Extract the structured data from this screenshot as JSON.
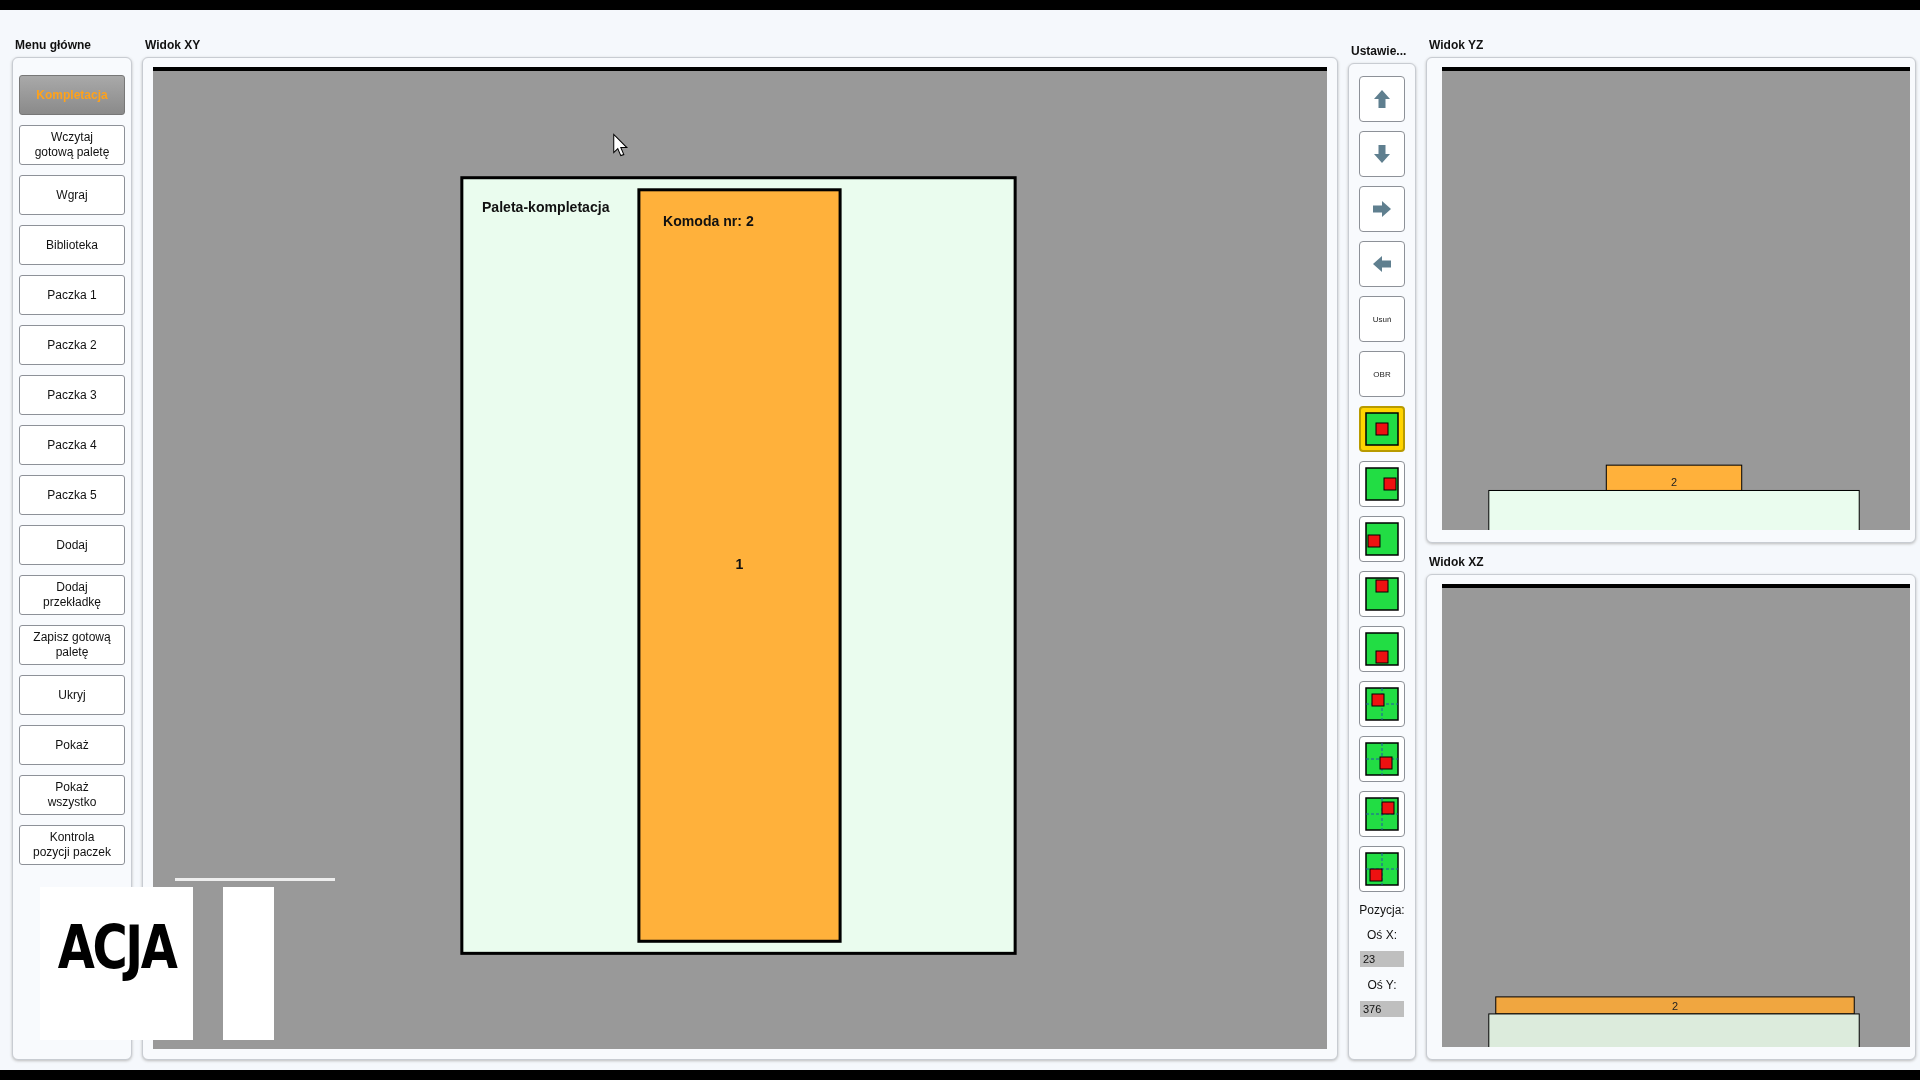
{
  "menu": {
    "title": "Menu główne",
    "items": [
      {
        "label": "Kompletacja",
        "selected": true
      },
      {
        "label": "Wczytaj gotową paletę",
        "selected": false
      },
      {
        "label": "Wgraj",
        "selected": false
      },
      {
        "label": "Biblioteka",
        "selected": false
      },
      {
        "label": "Paczka 1",
        "selected": false
      },
      {
        "label": "Paczka 2",
        "selected": false
      },
      {
        "label": "Paczka 3",
        "selected": false
      },
      {
        "label": "Paczka 4",
        "selected": false
      },
      {
        "label": "Paczka 5",
        "selected": false
      },
      {
        "label": "Dodaj",
        "selected": false
      },
      {
        "label": "Dodaj przekładkę",
        "selected": false
      },
      {
        "label": "Zapisz gotową paletę",
        "selected": false
      },
      {
        "label": "Ukryj",
        "selected": false
      },
      {
        "label": "Pokaż",
        "selected": false
      },
      {
        "label": "Pokaż wszystko",
        "selected": false
      },
      {
        "label": "Kontrola pozycji paczek",
        "selected": false
      }
    ]
  },
  "xy_view": {
    "title": "Widok XY",
    "pallet_label": "Paleta-kompletacja",
    "box_title": "Komoda nr: 2",
    "box_number": "1"
  },
  "settings": {
    "title": "Ustawie...",
    "tools": [
      {
        "kind": "up",
        "selected": false
      },
      {
        "kind": "down",
        "selected": false
      },
      {
        "kind": "right",
        "selected": false
      },
      {
        "kind": "left",
        "selected": false
      },
      {
        "kind": "label",
        "label": "Usuń",
        "selected": false
      },
      {
        "kind": "label",
        "label": "OBR",
        "selected": false
      },
      {
        "kind": "center",
        "selected": true
      },
      {
        "kind": "east",
        "selected": false
      },
      {
        "kind": "west",
        "selected": false
      },
      {
        "kind": "north",
        "selected": false
      },
      {
        "kind": "south",
        "selected": false
      },
      {
        "kind": "northwest",
        "selected": false
      },
      {
        "kind": "southeast",
        "selected": false
      },
      {
        "kind": "northeast",
        "selected": false
      },
      {
        "kind": "southwest",
        "selected": false
      }
    ],
    "position_label": "Pozycja:",
    "x_label": "Oś X:",
    "x_value": "23",
    "y_label": "Oś Y:",
    "y_value": "376"
  },
  "yz_view": {
    "title": "Widok YZ",
    "box_number": "2"
  },
  "xz_view": {
    "title": "Widok XZ",
    "box_number": "2"
  },
  "overlay": {
    "caption": "ACJA"
  }
}
